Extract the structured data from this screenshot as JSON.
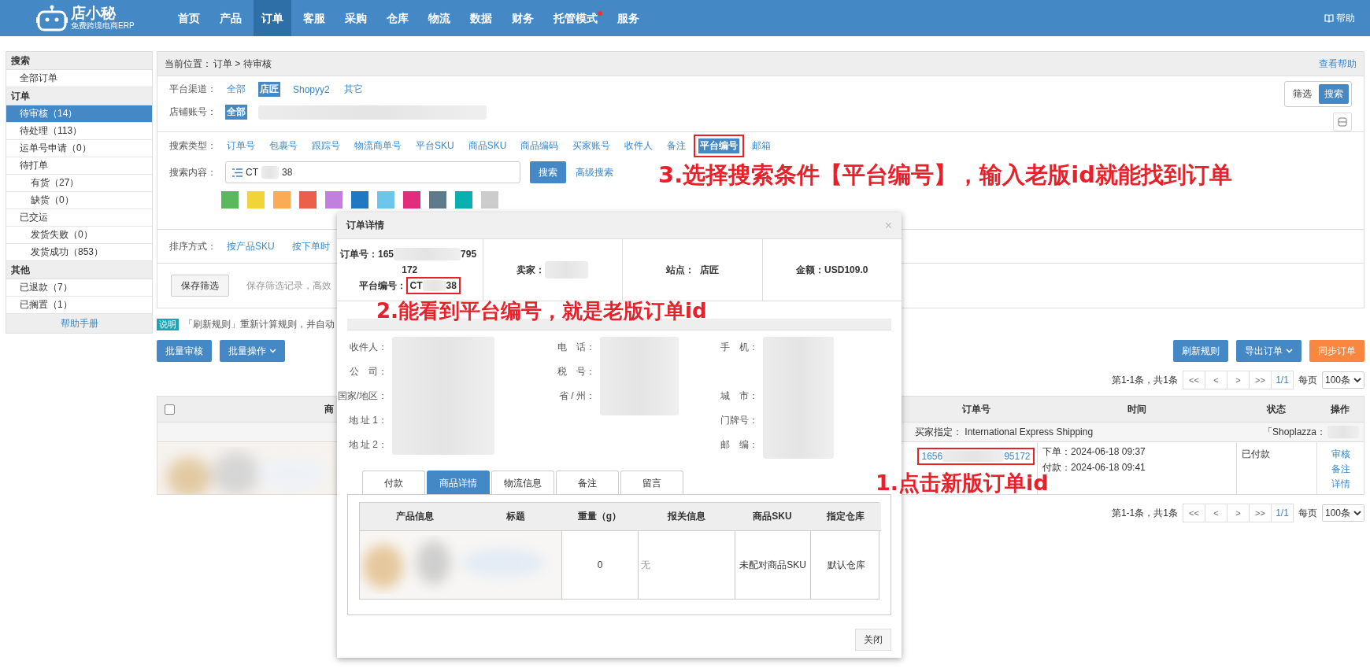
{
  "nav": {
    "logo": "店小秘",
    "tagline": "免费跨境电商ERP",
    "help": "帮助",
    "items": [
      {
        "label": "首页",
        "selected": false,
        "badge": false
      },
      {
        "label": "产品",
        "selected": false,
        "badge": false
      },
      {
        "label": "订单",
        "selected": true,
        "badge": false
      },
      {
        "label": "客服",
        "selected": false,
        "badge": false
      },
      {
        "label": "采购",
        "selected": false,
        "badge": false
      },
      {
        "label": "仓库",
        "selected": false,
        "badge": false
      },
      {
        "label": "物流",
        "selected": false,
        "badge": false
      },
      {
        "label": "数据",
        "selected": false,
        "badge": false
      },
      {
        "label": "财务",
        "selected": false,
        "badge": false
      },
      {
        "label": "托管模式",
        "selected": false,
        "badge": true
      },
      {
        "label": "服务",
        "selected": false,
        "badge": false
      }
    ]
  },
  "sidebar": {
    "manual": "帮助手册",
    "sections": [
      {
        "title": "搜索",
        "items": [
          {
            "label": "全部订单",
            "selected": false
          }
        ]
      },
      {
        "title": "订单",
        "items": [
          {
            "label": "待审核（14）",
            "selected": true
          },
          {
            "label": "待处理（113）",
            "selected": false
          },
          {
            "label": "运单号申请（0）",
            "selected": false
          },
          {
            "label": "待打单",
            "selected": false,
            "children": [
              {
                "label": "有货（27）",
                "selected": false
              },
              {
                "label": "缺货（0）",
                "selected": false
              }
            ]
          },
          {
            "label": "已交运",
            "selected": false,
            "children": [
              {
                "label": "发货失败（0）",
                "selected": false
              },
              {
                "label": "发货成功（853）",
                "selected": false
              }
            ]
          }
        ]
      },
      {
        "title": "其他",
        "items": [
          {
            "label": "已退款（7）",
            "selected": false
          },
          {
            "label": "已搁置（1）",
            "selected": false
          }
        ]
      }
    ]
  },
  "breadcrumb": {
    "label": "当前位置：",
    "trail": "订单 > 待审核",
    "help": "查看帮助"
  },
  "mode_toggle": [
    {
      "label": "筛选",
      "selected": false
    },
    {
      "label": "搜索",
      "selected": true
    }
  ],
  "filters": {
    "channel": {
      "label": "平台渠道：",
      "options": [
        {
          "label": "全部",
          "selected": false
        },
        {
          "label": "店匠",
          "selected": true
        },
        {
          "label": "Shopyy2",
          "selected": false
        },
        {
          "label": "其它",
          "selected": false
        }
      ]
    },
    "shop": {
      "label": "店铺账号：",
      "options": [
        {
          "label": "全部",
          "selected": true
        }
      ]
    },
    "search_type": {
      "label": "搜索类型：",
      "options": [
        {
          "label": "订单号",
          "selected": false
        },
        {
          "label": "包裹号",
          "selected": false
        },
        {
          "label": "跟踪号",
          "selected": false
        },
        {
          "label": "物流商单号",
          "selected": false
        },
        {
          "label": "平台SKU",
          "selected": false
        },
        {
          "label": "商品SKU",
          "selected": false
        },
        {
          "label": "商品编码",
          "selected": false
        },
        {
          "label": "买家账号",
          "selected": false
        },
        {
          "label": "收件人",
          "selected": false
        },
        {
          "label": "备注",
          "selected": false
        },
        {
          "label": "平台编号",
          "selected": true
        },
        {
          "label": "邮箱",
          "selected": false
        }
      ]
    },
    "search_content": {
      "label": "搜索内容：",
      "value_start": "CT",
      "value_end": "38",
      "button": "搜索",
      "advanced": "高级搜索"
    },
    "colors": [
      {
        "color": "#5cb85c"
      },
      {
        "color": "#f0d43a"
      },
      {
        "color": "#fbab54"
      },
      {
        "color": "#ec5f4d"
      },
      {
        "color": "#c17fe0"
      },
      {
        "color": "#1f78c1"
      },
      {
        "color": "#6bc6ea"
      },
      {
        "color": "#e22d7c"
      },
      {
        "color": "#5f7a88"
      },
      {
        "color": "#0aafb0"
      },
      {
        "color": "#cccccc"
      }
    ],
    "sort": {
      "label": "排序方式：",
      "options": [
        "按产品SKU",
        "按下单时"
      ]
    },
    "save": {
      "button": "保存筛选",
      "hint": "保存筛选记录，高效"
    }
  },
  "notice": {
    "badge": "说明",
    "text": "「刷新规则」重新计算规则，并自动"
  },
  "actions_left": [
    {
      "label": "批量审核",
      "dropdown": false
    },
    {
      "label": "批量操作",
      "dropdown": true
    }
  ],
  "actions_right": [
    {
      "label": "刷新规则",
      "kind": "primary",
      "dropdown": false
    },
    {
      "label": "导出订单",
      "kind": "primary",
      "dropdown": true
    },
    {
      "label": "同步订单",
      "kind": "warning",
      "dropdown": false
    }
  ],
  "pagination_top": {
    "summary": "第1-1条，共1条",
    "buttons": [
      "<<",
      "<",
      ">",
      ">>"
    ],
    "page": "1/1",
    "per_page_label": "每页",
    "per_page": "100条"
  },
  "table": {
    "select_all": {
      "checked": false
    },
    "columns": [
      "商",
      "订单号",
      "时间",
      "状态",
      "操作"
    ],
    "group": {
      "shipping_label": "买家指定：",
      "shipping": "International Express Shipping",
      "store": "「Shoplazza："
    },
    "rows": [
      {
        "order_start": "1656",
        "order_end": "95172",
        "placed": "下单：2024-06-18 09:37",
        "paid": "付款：2024-06-18 09:41",
        "status": "已付款",
        "actions": [
          "审核",
          "备注",
          "详情"
        ]
      }
    ]
  },
  "pagination_bottom": {
    "summary": "第1-1条，共1条",
    "buttons": [
      "<<",
      "<",
      ">",
      ">>"
    ],
    "page": "1/1",
    "per_page_label": "每页",
    "per_page": "100条"
  },
  "modal": {
    "title": "订单详情",
    "close": "×",
    "order_label": "订单号：",
    "order_start": "165",
    "order_end": "795",
    "order_line2": "172",
    "platform_label": "平台编号：",
    "platform_start": "CT",
    "platform_end": "38",
    "seller_label": "卖家：",
    "site": "站点：  店匠",
    "amount": "金额：USD109.0",
    "address_rows": [
      [
        "收件人：",
        "电　话：",
        "手　机："
      ],
      [
        "公　司：",
        "税　号：",
        null
      ],
      [
        "国家/地区：",
        "省 / 州：",
        "城　市："
      ],
      [
        "地 址 1：",
        null,
        "门牌号："
      ],
      [
        "地 址 2：",
        null,
        "邮　编："
      ]
    ],
    "tabs": [
      {
        "label": "付款",
        "selected": false
      },
      {
        "label": "商品详情",
        "selected": true
      },
      {
        "label": "物流信息",
        "selected": false
      },
      {
        "label": "备注",
        "selected": false
      },
      {
        "label": "留言",
        "selected": false
      }
    ],
    "product_columns": [
      "产品信息",
      "标题",
      "重量（g）",
      "报关信息",
      "商品SKU",
      "指定仓库"
    ],
    "product_row": {
      "weight": "0",
      "customs": "无",
      "sku": "未配对商品SKU",
      "warehouse": "默认仓库"
    },
    "close_button": "关闭"
  },
  "annotations": {
    "search": "3.选择搜索条件【平台编号】，输入老版id就能找到订单",
    "modal": "2.能看到平台编号，就是老版订单id",
    "order": "1.点击新版订单id"
  }
}
